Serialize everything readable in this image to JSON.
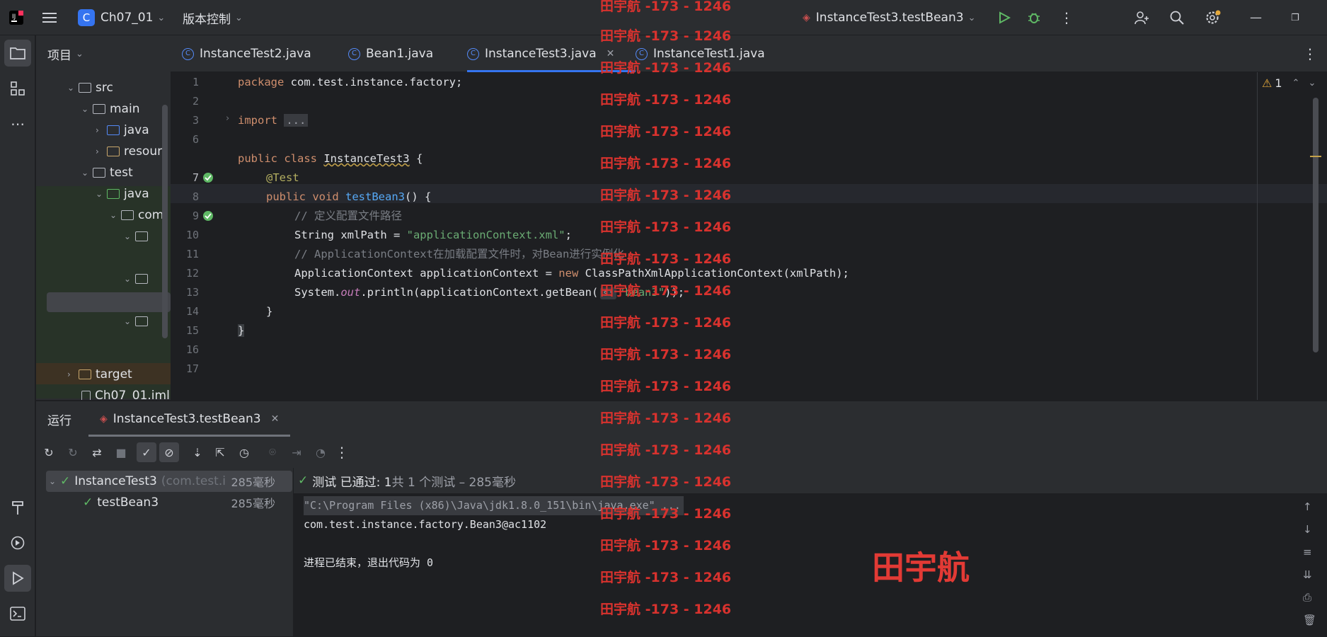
{
  "topbar": {
    "project_badge": "C",
    "project_name": "Ch07_01",
    "vcs_label": "版本控制",
    "run_config": "InstanceTest3.testBean3"
  },
  "project_tool": {
    "title": "项目",
    "rows": [
      {
        "label": "src"
      },
      {
        "label": "main"
      },
      {
        "label": "java"
      },
      {
        "label": "resour"
      },
      {
        "label": "test"
      },
      {
        "label": "java"
      },
      {
        "label": "com"
      },
      {
        "label": "target"
      },
      {
        "label": "Ch07_01.iml"
      }
    ]
  },
  "editor": {
    "tabs": [
      {
        "label": "InstanceTest2.java"
      },
      {
        "label": "Bean1.java"
      },
      {
        "label": "InstanceTest3.java"
      },
      {
        "label": "InstanceTest1.java"
      }
    ],
    "warning_count": "1",
    "line_numbers": [
      "1",
      "2",
      "3",
      "6",
      "7",
      "8",
      "9",
      "10",
      "11",
      "12",
      "13",
      "14",
      "15",
      "16",
      "17"
    ],
    "code": {
      "l1_kw": "package",
      "l1_rest": " com.test.instance.factory;",
      "l3_kw": "import",
      "l3_fold": "...",
      "l7_kw": "public class",
      "l7_name": "InstanceTest3",
      "l7_rest": " {",
      "l8_ann": "@Test",
      "l9_kw": "public void",
      "l9_fn": "testBean3",
      "l9_rest": "() {",
      "l10_com": "// 定义配置文件路径",
      "l11_type": "String xmlPath = ",
      "l11_str": "\"applicationContext.xml\"",
      "l11_end": ";",
      "l12_com": "// ApplicationContext在加载配置文件时，对Bean进行实例化",
      "l13_a": "ApplicationContext applicationContext = ",
      "l13_kw": "new",
      "l13_b": " ClassPathXmlApplicationContext(xmlPath);",
      "l14_a": "System.",
      "l14_it": "out",
      "l14_b": ".println(applicationContext.getBean(",
      "l14_hint": "s:",
      "l14_str": "\"bean3\"",
      "l14_end": "));",
      "l15": "}",
      "l16": "}"
    }
  },
  "run": {
    "title": "运行",
    "tab_label": "InstanceTest3.testBean3",
    "tests": [
      {
        "name": "InstanceTest3",
        "pkg": "(com.test.i",
        "duration": "285毫秒"
      },
      {
        "name": "testBean3",
        "duration": "285毫秒"
      }
    ],
    "status_pass": "测试 已通过: 1",
    "status_total": "共 1 个测试 – 285毫秒",
    "console": [
      "\"C:\\Program Files (x86)\\Java\\jdk1.8.0_151\\bin\\java.exe\" ...",
      "com.test.instance.factory.Bean3@ac1102",
      "",
      "进程已结束，退出代码为 0"
    ]
  },
  "watermark": {
    "repeat_text": "田宇航 -173 - 1246",
    "big_text": "田宇航"
  },
  "colors": {
    "accent": "#3574f0",
    "pass": "#5fb865",
    "watermark": "#d8322e"
  }
}
